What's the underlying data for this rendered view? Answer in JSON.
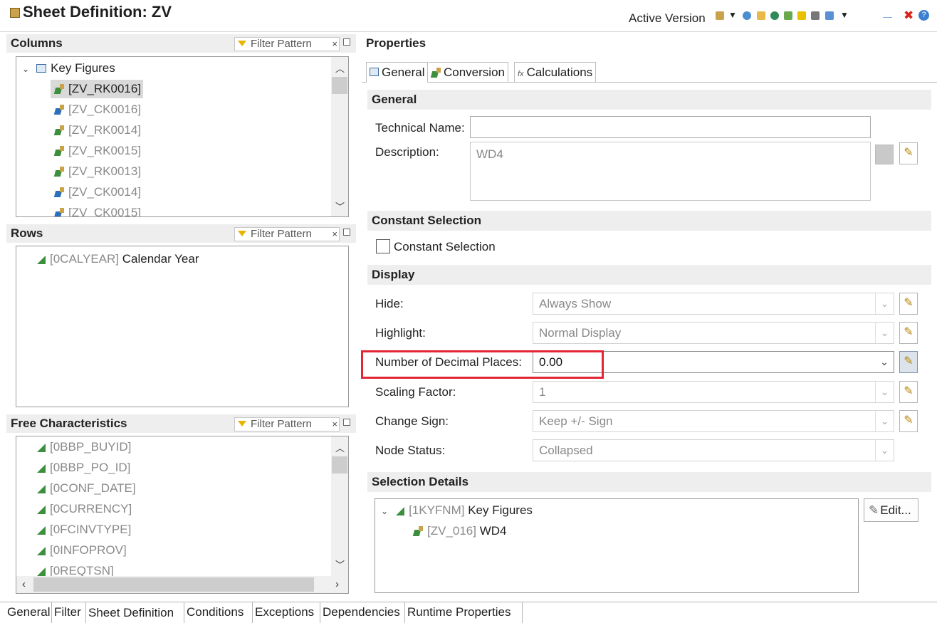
{
  "header": {
    "title": "Sheet Definition: ZV",
    "active_version_label": "Active Version"
  },
  "columns": {
    "title": "Columns",
    "filter_placeholder": "Filter Pattern",
    "tree_root": "Key Figures",
    "items": [
      {
        "code": "[ZV_RK0016]",
        "type": "rk",
        "selected": true
      },
      {
        "code": "[ZV_CK0016]",
        "type": "ck"
      },
      {
        "code": "[ZV_RK0014]",
        "type": "rk"
      },
      {
        "code": "[ZV_RK0015]",
        "type": "rk"
      },
      {
        "code": "[ZV_RK0013]",
        "type": "rk"
      },
      {
        "code": "[ZV_CK0014]",
        "type": "ck"
      },
      {
        "code": "[ZV_CK0015]",
        "type": "ck"
      }
    ]
  },
  "rows": {
    "title": "Rows",
    "filter_placeholder": "Filter Pattern",
    "items": [
      {
        "code": "[0CALYEAR]",
        "name": "Calendar Year"
      }
    ]
  },
  "free_characteristics": {
    "title": "Free Characteristics",
    "filter_placeholder": "Filter Pattern",
    "items": [
      "[0BBP_BUYID]",
      "[0BBP_PO_ID]",
      "[0CONF_DATE]",
      "[0CURRENCY]",
      "[0FCINVTYPE]",
      "[0INFOPROV]",
      "[0REQTSN]"
    ]
  },
  "properties": {
    "title": "Properties",
    "tabs": [
      "General",
      "Conversion",
      "Calculations"
    ],
    "general_section": "General",
    "technical_name_label": "Technical Name:",
    "technical_name_value": "",
    "description_label": "Description:",
    "description_value": "WD4",
    "constant_selection_section": "Constant Selection",
    "constant_selection_checkbox": "Constant Selection",
    "display_section": "Display",
    "display_fields": [
      {
        "label": "Hide:",
        "value": "Always Show",
        "pen": true
      },
      {
        "label": "Highlight:",
        "value": "Normal Display",
        "pen": true
      },
      {
        "label": "Number of Decimal Places:",
        "value": "0.00",
        "pen": true,
        "active": true
      },
      {
        "label": "Scaling Factor:",
        "value": "1",
        "pen": true
      },
      {
        "label": "Change Sign:",
        "value": "Keep +/- Sign",
        "pen": true
      },
      {
        "label": "Node Status:",
        "value": "Collapsed",
        "pen": false
      }
    ],
    "selection_details_section": "Selection Details",
    "selection_root_code": "[1KYFNM]",
    "selection_root_name": "Key Figures",
    "selection_child_code": "[ZV_016]",
    "selection_child_name": "WD4",
    "edit_button": "Edit..."
  },
  "bottom_tabs": [
    "General",
    "Filter",
    "Sheet Definition",
    "Conditions",
    "Exceptions",
    "Dependencies",
    "Runtime Properties"
  ],
  "active_bottom_tab": "Sheet Definition",
  "colors": {
    "highlight_box": "#e32636",
    "section_bg": "#eeeeee"
  }
}
